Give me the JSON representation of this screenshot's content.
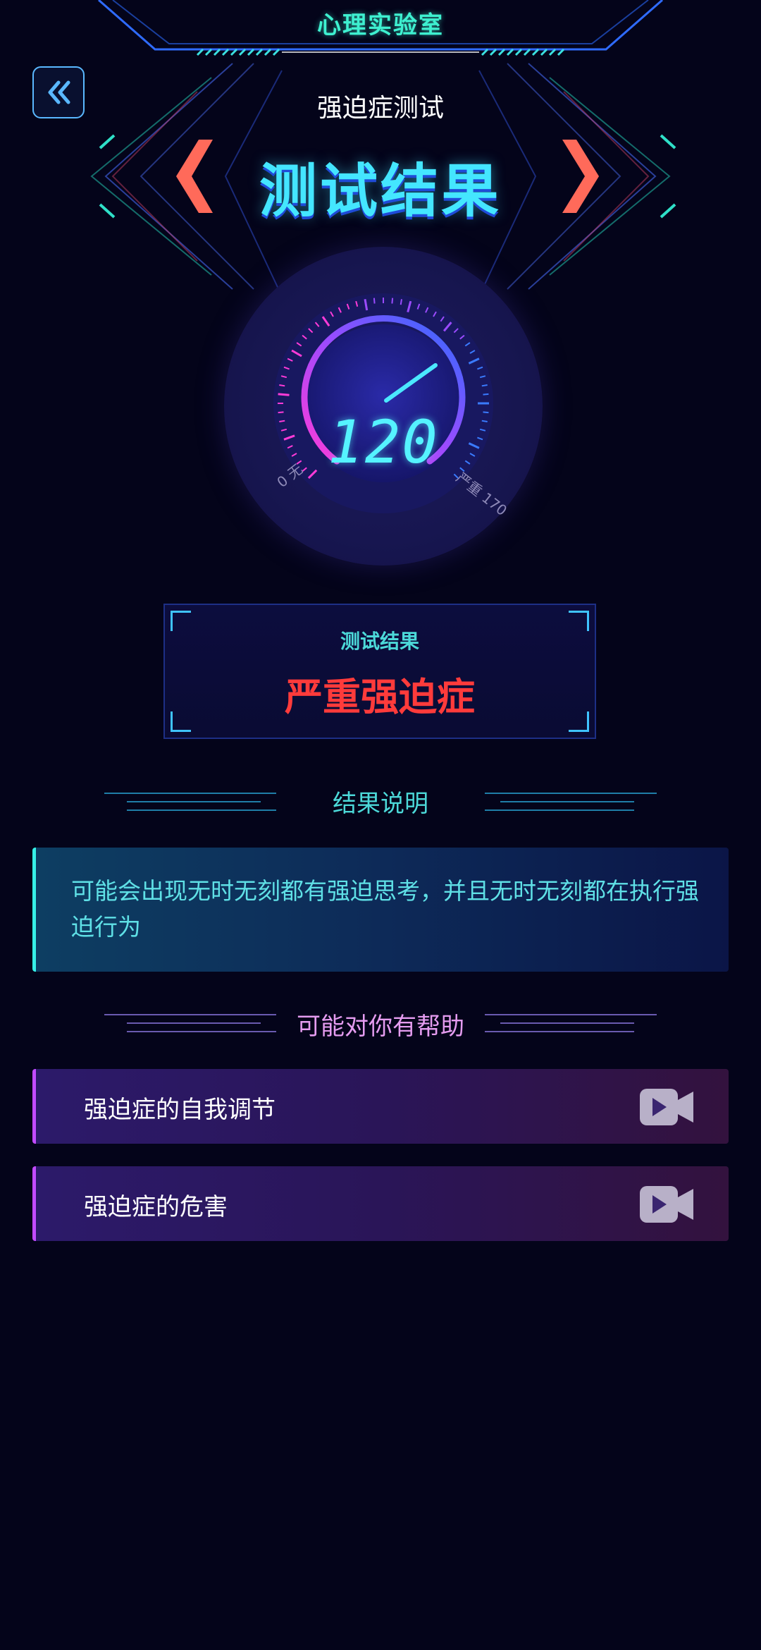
{
  "header": {
    "app_title": "心理实验室",
    "subtitle": "强迫症测试",
    "main_title": "测试结果"
  },
  "gauge": {
    "value": "120",
    "min_label": "0 无",
    "max_label": "严重 170"
  },
  "result": {
    "label": "测试结果",
    "value": "严重强迫症"
  },
  "explanation": {
    "section_title": "结果说明",
    "text": "可能会出现无时无刻都有强迫思考，并且无时无刻都在执行强迫行为"
  },
  "help": {
    "section_title": "可能对你有帮助",
    "items": [
      {
        "label": "强迫症的自我调节",
        "icon": "video-camera-icon"
      },
      {
        "label": "强迫症的危害",
        "icon": "video-camera-icon"
      }
    ]
  },
  "colors": {
    "background": "#04041a",
    "accent_cyan": "#44e6ff",
    "danger_red": "#ff3b3b",
    "purple_accent": "#c24bff"
  }
}
